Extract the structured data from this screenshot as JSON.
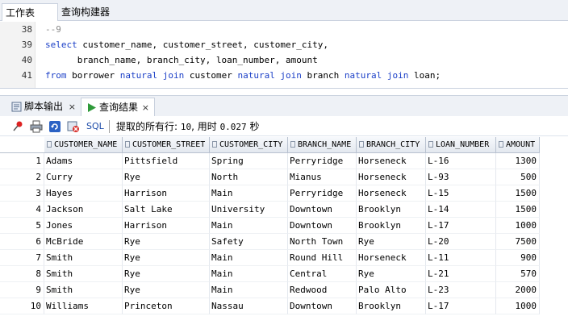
{
  "top_tabs": [
    {
      "label": "工作表"
    },
    {
      "label": "查询构建器"
    }
  ],
  "editor": {
    "lines": [
      {
        "num": "38",
        "text": "--9"
      },
      {
        "num": "39",
        "kw": "select",
        "text": " customer_name, customer_street, customer_city,"
      },
      {
        "num": "40",
        "text": "      branch_name, branch_city, loan_number, amount"
      },
      {
        "num": "41",
        "parts": [
          "from",
          " borrower ",
          "natural join",
          " customer ",
          "natural join",
          " branch ",
          "natural join",
          " loan;"
        ]
      }
    ]
  },
  "panel_tabs": [
    {
      "label": "脚本输出",
      "close": "×"
    },
    {
      "label": "查询结果",
      "close": "×"
    }
  ],
  "toolbar": {
    "sql_label": "SQL",
    "status_prefix": "提取的所有行: ",
    "rows_fetched": "10",
    "status_mid": ", 用时 ",
    "time": "0.027",
    "status_suffix": " 秒"
  },
  "grid": {
    "columns": [
      "CUSTOMER_NAME",
      "CUSTOMER_STREET",
      "CUSTOMER_CITY",
      "BRANCH_NAME",
      "BRANCH_CITY",
      "LOAN_NUMBER",
      "AMOUNT"
    ],
    "rows": [
      [
        "1",
        "Adams",
        "Pittsfield",
        "Spring",
        "Perryridge",
        "Horseneck",
        "L-16",
        "1300"
      ],
      [
        "2",
        "Curry",
        "Rye",
        "North",
        "Mianus",
        "Horseneck",
        "L-93",
        "500"
      ],
      [
        "3",
        "Hayes",
        "Harrison",
        "Main",
        "Perryridge",
        "Horseneck",
        "L-15",
        "1500"
      ],
      [
        "4",
        "Jackson",
        "Salt Lake",
        "University",
        "Downtown",
        "Brooklyn",
        "L-14",
        "1500"
      ],
      [
        "5",
        "Jones",
        "Harrison",
        "Main",
        "Downtown",
        "Brooklyn",
        "L-17",
        "1000"
      ],
      [
        "6",
        "McBride",
        "Rye",
        "Safety",
        "North Town",
        "Rye",
        "L-20",
        "7500"
      ],
      [
        "7",
        "Smith",
        "Rye",
        "Main",
        "Round Hill",
        "Horseneck",
        "L-11",
        "900"
      ],
      [
        "8",
        "Smith",
        "Rye",
        "Main",
        "Central",
        "Rye",
        "L-21",
        "570"
      ],
      [
        "9",
        "Smith",
        "Rye",
        "Main",
        "Redwood",
        "Palo Alto",
        "L-23",
        "2000"
      ],
      [
        "10",
        "Williams",
        "Princeton",
        "Nassau",
        "Downtown",
        "Brooklyn",
        "L-17",
        "1000"
      ]
    ]
  },
  "colors": {
    "keyword": "#1b3fc7",
    "comment": "#8a8a8a",
    "tab_bg": "#eef1f6"
  },
  "icons": [
    "pin-icon",
    "print-icon",
    "refresh-icon",
    "delete-icon",
    "script-output-icon",
    "query-result-icon"
  ]
}
